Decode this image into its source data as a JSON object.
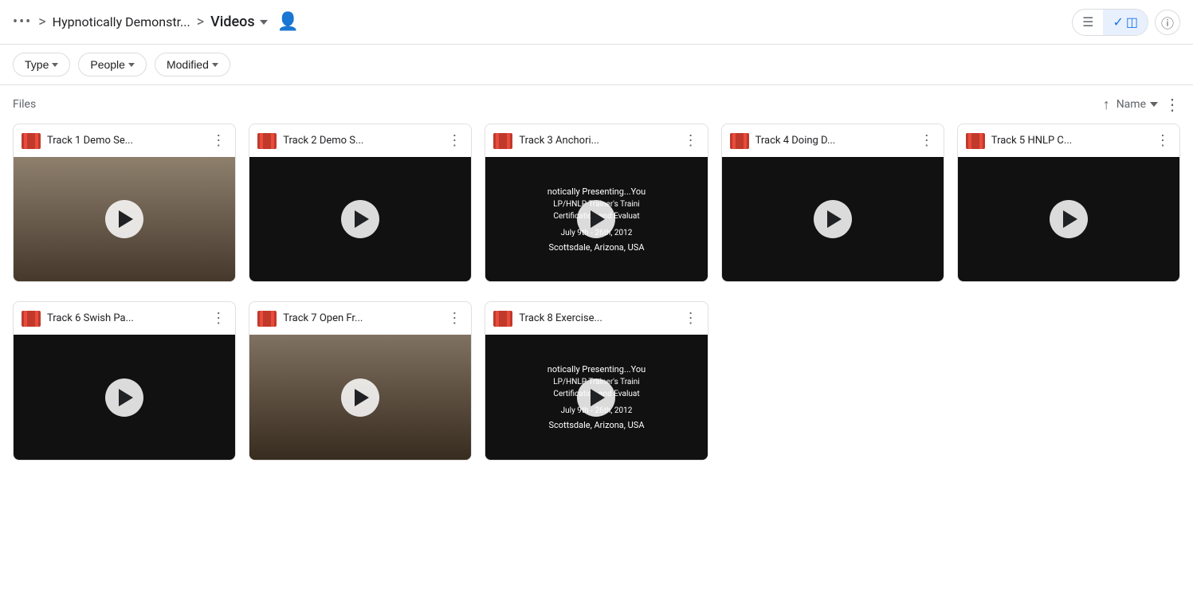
{
  "header": {
    "dots_label": "•••",
    "sep1": ">",
    "breadcrumb1": "Hypnotically Demonstr...",
    "sep2": ">",
    "breadcrumb2": "Videos",
    "list_view_icon": "≡",
    "grid_view_icon": "⊞",
    "check_icon": "✓",
    "info_icon": "ⓘ",
    "person_icon": "👤"
  },
  "filters": {
    "type_label": "Type",
    "people_label": "People",
    "modified_label": "Modified"
  },
  "files_section": {
    "label": "Files",
    "sort_direction": "↑",
    "sort_name": "Name",
    "more_options": "⋮"
  },
  "videos": [
    {
      "id": "v1",
      "title": "Track 1 Demo Se...",
      "has_thumb": true,
      "thumb_type": "room"
    },
    {
      "id": "v2",
      "title": "Track 2 Demo S...",
      "has_thumb": false,
      "thumb_type": "dark"
    },
    {
      "id": "v3",
      "title": "Track 3 Anchori...",
      "has_thumb": false,
      "thumb_type": "text",
      "thumb_lines": [
        "notically Presenting...You",
        "LP/HNLP Trainer's Traini",
        "Certification and Evaluat",
        "July 9th - 26th, 2012",
        "Scottsdale, Arizona, USA"
      ]
    },
    {
      "id": "v4",
      "title": "Track 4 Doing D...",
      "has_thumb": false,
      "thumb_type": "dark"
    },
    {
      "id": "v5",
      "title": "Track 5 HNLP C...",
      "has_thumb": false,
      "thumb_type": "dark"
    },
    {
      "id": "v6",
      "title": "Track 6 Swish Pa...",
      "has_thumb": false,
      "thumb_type": "dark"
    },
    {
      "id": "v7",
      "title": "Track 7 Open Fr...",
      "has_thumb": true,
      "thumb_type": "room2"
    },
    {
      "id": "v8",
      "title": "Track 8 Exercise...",
      "has_thumb": false,
      "thumb_type": "text",
      "thumb_lines": [
        "notically Presenting...You",
        "LP/HNLP Trainer's Traini",
        "Certification and Evaluat",
        "July 9th - 26th, 2012",
        "Scottsdale, Arizona, USA"
      ]
    }
  ]
}
